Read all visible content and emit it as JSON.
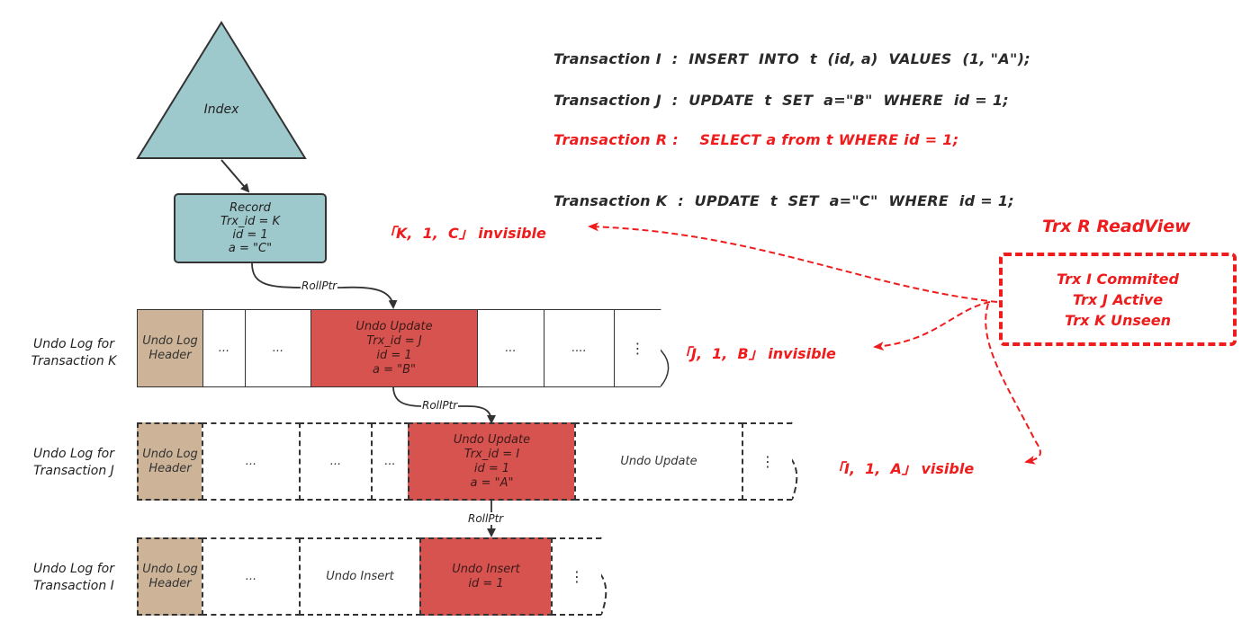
{
  "index": {
    "label": "Index"
  },
  "record": {
    "title": "Record",
    "lines": [
      "Trx_id = K",
      "id = 1",
      "a = \"C\""
    ]
  },
  "transactions": [
    {
      "name": "Transaction I",
      "sep": ":",
      "sql": "INSERT  INTO  t  (id, a)  VALUES  (1, \"A\");",
      "highlight": false
    },
    {
      "name": "Transaction J",
      "sep": ":",
      "sql": "UPDATE  t  SET  a=\"B\"  WHERE  id = 1;",
      "highlight": false
    },
    {
      "name": "Transaction R",
      "sep": ":",
      "sql": "SELECT a from t WHERE id = 1;",
      "highlight": true
    },
    {
      "name": "Transaction K",
      "sep": ":",
      "sql": "UPDATE  t  SET  a=\"C\"  WHERE  id = 1;",
      "highlight": false
    }
  ],
  "readview": {
    "title": "Trx R ReadView",
    "lines": [
      "Trx I Commited",
      "Trx J Active",
      "Trx K Unseen"
    ]
  },
  "results": [
    {
      "text": "「K,  1,  C」 invisible",
      "visible": false
    },
    {
      "text": "「J,  1,  B」 invisible",
      "visible": false
    },
    {
      "text": "「I,  1,  A」 visible",
      "visible": true
    }
  ],
  "rollptr_label": "RollPtr",
  "undo_logs": [
    {
      "label": [
        "Undo Log for",
        "Transaction K"
      ],
      "border": "solid",
      "cells": [
        {
          "kind": "header",
          "lines": [
            "Undo Log",
            "Header"
          ]
        },
        {
          "kind": "white",
          "lines": [
            "..."
          ]
        },
        {
          "kind": "white",
          "lines": [
            "..."
          ]
        },
        {
          "kind": "red",
          "lines": [
            "Undo Update",
            "Trx_id = J",
            "id = 1",
            "a = \"B\""
          ]
        },
        {
          "kind": "white",
          "lines": [
            "..."
          ]
        },
        {
          "kind": "white",
          "lines": [
            "...."
          ]
        },
        {
          "kind": "end",
          "lines": [
            "⋮"
          ]
        }
      ]
    },
    {
      "label": [
        "Undo Log for",
        "Transaction J"
      ],
      "border": "dashed",
      "cells": [
        {
          "kind": "header",
          "lines": [
            "Undo Log",
            "Header"
          ]
        },
        {
          "kind": "white",
          "lines": [
            "..."
          ]
        },
        {
          "kind": "white",
          "lines": [
            "..."
          ]
        },
        {
          "kind": "white",
          "lines": [
            "..."
          ]
        },
        {
          "kind": "red",
          "lines": [
            "Undo Update",
            "Trx_id = I",
            "id = 1",
            "a = \"A\""
          ]
        },
        {
          "kind": "white",
          "lines": [
            "Undo Update"
          ]
        },
        {
          "kind": "end",
          "lines": [
            "⋮"
          ]
        }
      ]
    },
    {
      "label": [
        "Undo Log for",
        "Transaction I"
      ],
      "border": "dashed",
      "cells": [
        {
          "kind": "header",
          "lines": [
            "Undo Log",
            "Header"
          ]
        },
        {
          "kind": "white",
          "lines": [
            "..."
          ]
        },
        {
          "kind": "white",
          "lines": [
            "Undo Insert"
          ]
        },
        {
          "kind": "red",
          "lines": [
            "Undo Insert",
            "id = 1"
          ]
        },
        {
          "kind": "end",
          "lines": [
            "⋮"
          ]
        }
      ]
    }
  ]
}
